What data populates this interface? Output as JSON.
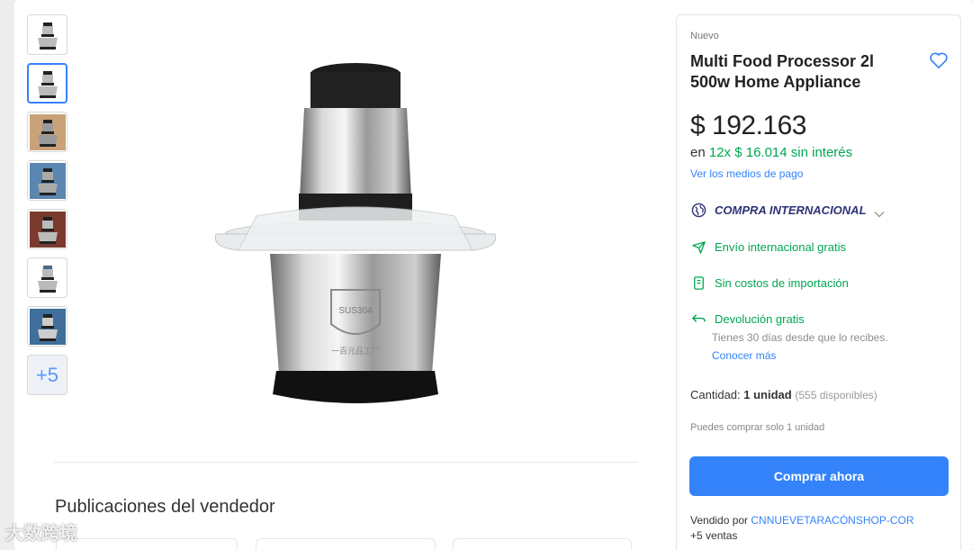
{
  "gallery": {
    "thumbnails": [
      {
        "name": "thumbnail-1",
        "active": false
      },
      {
        "name": "thumbnail-2",
        "active": true
      },
      {
        "name": "thumbnail-3",
        "active": false
      },
      {
        "name": "thumbnail-4",
        "active": false
      },
      {
        "name": "thumbnail-5",
        "active": false
      },
      {
        "name": "thumbnail-6",
        "active": false
      },
      {
        "name": "thumbnail-7",
        "active": false
      }
    ],
    "more_label": "+5"
  },
  "main_image": {
    "icon": "food-processor-image",
    "shield_text_top": "SUS304",
    "band_text": "一百元品工厂"
  },
  "seller_publications": {
    "heading": "Publicaciones del vendedor"
  },
  "watermark": {
    "text": "大数跨境"
  },
  "buybox": {
    "condition": "Nuevo",
    "title": "Multi Food Processor 2l 500w Home Appliance",
    "price": "$ 192.163",
    "installments_prefix": "en ",
    "installments_green": "12x $ 16.014 sin interés",
    "payment_link": "Ver los medios de pago",
    "international": "COMPRA INTERNACIONAL",
    "shipping": "Envío internacional gratis",
    "import_costs": "Sin costos de importación",
    "returns": "Devolución gratis",
    "returns_sub": "Tienes 30 días desde que lo recibes.",
    "returns_link": "Conocer más",
    "quantity_label": "Cantidad: ",
    "quantity_value": "1 unidad",
    "quantity_available": "(555 disponibles)",
    "limit_note": "Puedes comprar solo 1 unidad",
    "buy_button": "Comprar ahora",
    "sold_by_prefix": "Vendido por ",
    "seller_name": "CNNUEVETARACÓNSHOP-COR",
    "sales": "+5 ventas"
  },
  "colors": {
    "accent": "#3483fa",
    "green": "#00a650",
    "international": "#2d3277"
  }
}
